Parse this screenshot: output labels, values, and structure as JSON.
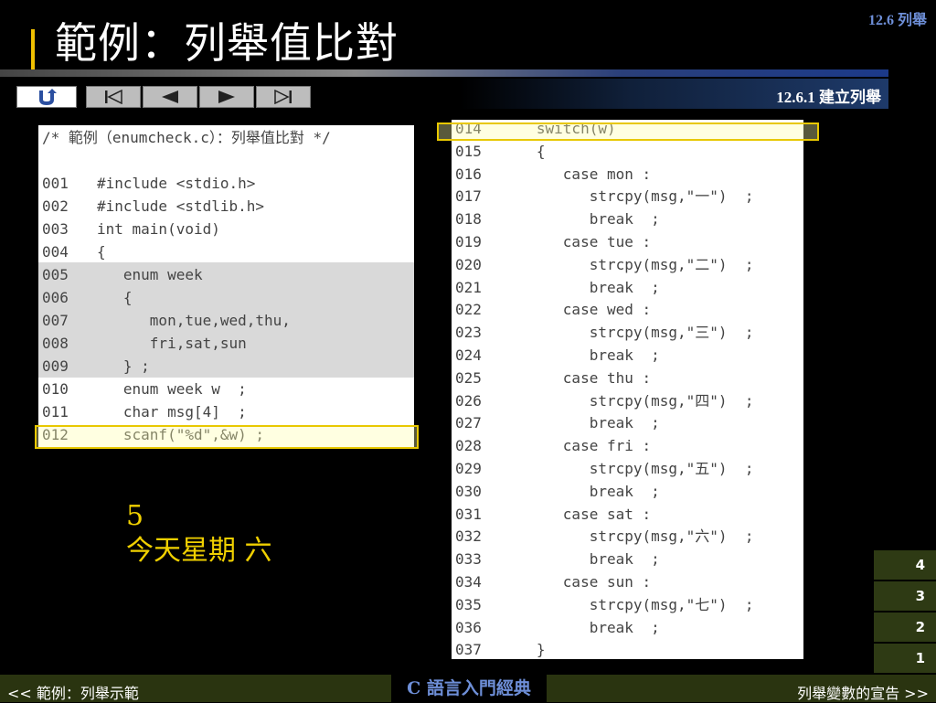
{
  "header": {
    "section_tag": "12.6 列舉",
    "title": "範例：列舉值比對",
    "subtitle": "12.6.1 建立列舉"
  },
  "nav": {
    "buttons": [
      {
        "name": "home-button",
        "icon": "return-icon"
      },
      {
        "name": "first-slide-button",
        "icon": "skip-back-icon"
      },
      {
        "name": "prev-slide-button",
        "icon": "play-left-icon"
      },
      {
        "name": "next-slide-button",
        "icon": "play-right-icon"
      },
      {
        "name": "last-slide-button",
        "icon": "skip-forward-icon"
      }
    ]
  },
  "left_code": {
    "header": "/* 範例（enumcheck.c）：列舉值比對 */",
    "lines": [
      {
        "n": "",
        "code": ""
      },
      {
        "n": "001",
        "code": "#include <stdio.h>"
      },
      {
        "n": "002",
        "code": "#include <stdlib.h>"
      },
      {
        "n": "003",
        "code": "int main(void)"
      },
      {
        "n": "004",
        "code": "{"
      },
      {
        "n": "005",
        "code": "   enum week"
      },
      {
        "n": "006",
        "code": "   {"
      },
      {
        "n": "007",
        "code": "      mon,tue,wed,thu,"
      },
      {
        "n": "008",
        "code": "      fri,sat,sun"
      },
      {
        "n": "009",
        "code": "   } ;"
      },
      {
        "n": "010",
        "code": "   enum week w  ;"
      },
      {
        "n": "011",
        "code": "   char msg[4]  ;"
      },
      {
        "n": "012",
        "code": "   scanf(\"%d\",&w) ;"
      }
    ]
  },
  "right_code": {
    "lines": [
      {
        "n": "014",
        "code": "   switch(w)"
      },
      {
        "n": "015",
        "code": "   {"
      },
      {
        "n": "016",
        "code": "      case mon :"
      },
      {
        "n": "017",
        "code": "         strcpy(msg,\"一\")  ;"
      },
      {
        "n": "018",
        "code": "         break  ;"
      },
      {
        "n": "019",
        "code": "      case tue :"
      },
      {
        "n": "020",
        "code": "         strcpy(msg,\"二\")  ;"
      },
      {
        "n": "021",
        "code": "         break  ;"
      },
      {
        "n": "022",
        "code": "      case wed :"
      },
      {
        "n": "023",
        "code": "         strcpy(msg,\"三\")  ;"
      },
      {
        "n": "024",
        "code": "         break  ;"
      },
      {
        "n": "025",
        "code": "      case thu :"
      },
      {
        "n": "026",
        "code": "         strcpy(msg,\"四\")  ;"
      },
      {
        "n": "027",
        "code": "         break  ;"
      },
      {
        "n": "028",
        "code": "      case fri :"
      },
      {
        "n": "029",
        "code": "         strcpy(msg,\"五\")  ;"
      },
      {
        "n": "030",
        "code": "         break  ;"
      },
      {
        "n": "031",
        "code": "      case sat :"
      },
      {
        "n": "032",
        "code": "         strcpy(msg,\"六\")  ;"
      },
      {
        "n": "033",
        "code": "         break  ;"
      },
      {
        "n": "034",
        "code": "      case sun :"
      },
      {
        "n": "035",
        "code": "         strcpy(msg,\"七\")  ;"
      },
      {
        "n": "036",
        "code": "         break  ;"
      },
      {
        "n": "037",
        "code": "   }"
      }
    ]
  },
  "output": {
    "line1": "5",
    "line2": "今天星期 六"
  },
  "pages": [
    "4",
    "3",
    "2",
    "1"
  ],
  "footer": {
    "prev": "<< 範例：列舉示範",
    "center": "C 語言入門經典",
    "next": "列舉變數的宣告 >>"
  },
  "colors": {
    "accent_yellow": "#f0d000",
    "title_blue": "#6e8fd8",
    "footer_olive": "#2a3410"
  }
}
